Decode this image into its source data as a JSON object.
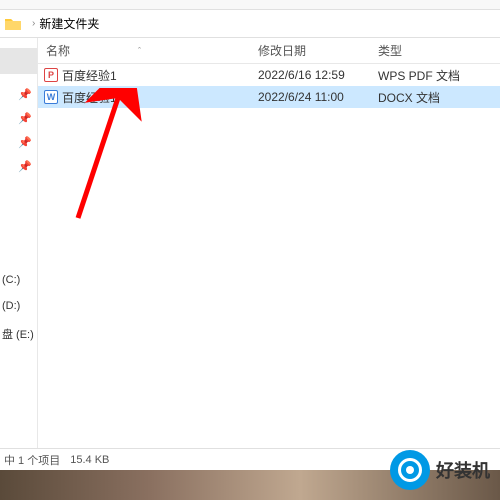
{
  "path": {
    "folder_name": "新建文件夹"
  },
  "columns": {
    "name": "名称",
    "date": "修改日期",
    "type": "类型"
  },
  "files": [
    {
      "name": "百度经验1",
      "date": "2022/6/16 12:59",
      "type": "WPS PDF 文档",
      "icon": "pdf",
      "selected": false
    },
    {
      "name": "百度经验1",
      "date": "2022/6/24 11:00",
      "type": "DOCX 文档",
      "icon": "docx",
      "selected": true
    }
  ],
  "sidebar": {
    "drives": [
      "(C:)",
      "(D:)",
      "盘 (E:)"
    ]
  },
  "status": {
    "selection": "中 1 个项目",
    "size": "15.4 KB"
  },
  "watermark": {
    "brand": "好装机"
  }
}
